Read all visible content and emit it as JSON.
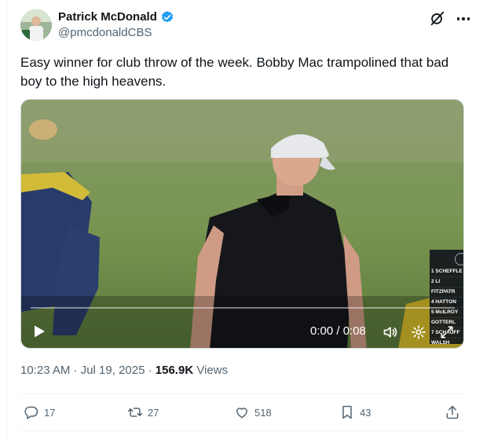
{
  "author": {
    "name": "Patrick McDonald",
    "handle": "@pmcdonaldCBS",
    "verified": true,
    "verified_color": "#1d9bf0"
  },
  "tweet": {
    "text": "Easy winner for club throw of the week. Bobby Mac trampolined that bad boy to the high heavens."
  },
  "video": {
    "time": "0:00 / 0:08",
    "progress_fraction": 0,
    "scorebug": [
      "1  SCHEFFLE",
      "2  LI",
      "   FITZPATR",
      "4  HATTON",
      "5  McILROY",
      "   GOTTERL",
      "7  SCHAUFF",
      "   WALSH"
    ]
  },
  "meta": {
    "timestamp": "10:23 AM · Jul 19, 2025 · ",
    "views_count": "156.9K",
    "views_label": " Views"
  },
  "actions": {
    "replies": "17",
    "reposts": "27",
    "likes": "518",
    "bookmarks": "43"
  },
  "icons": {
    "verified": "verified-badge-icon",
    "grok": "grok-icon",
    "more": "more-icon",
    "reply": "reply-icon",
    "repost": "repost-icon",
    "like": "like-icon",
    "bookmark": "bookmark-icon",
    "share": "share-icon"
  }
}
